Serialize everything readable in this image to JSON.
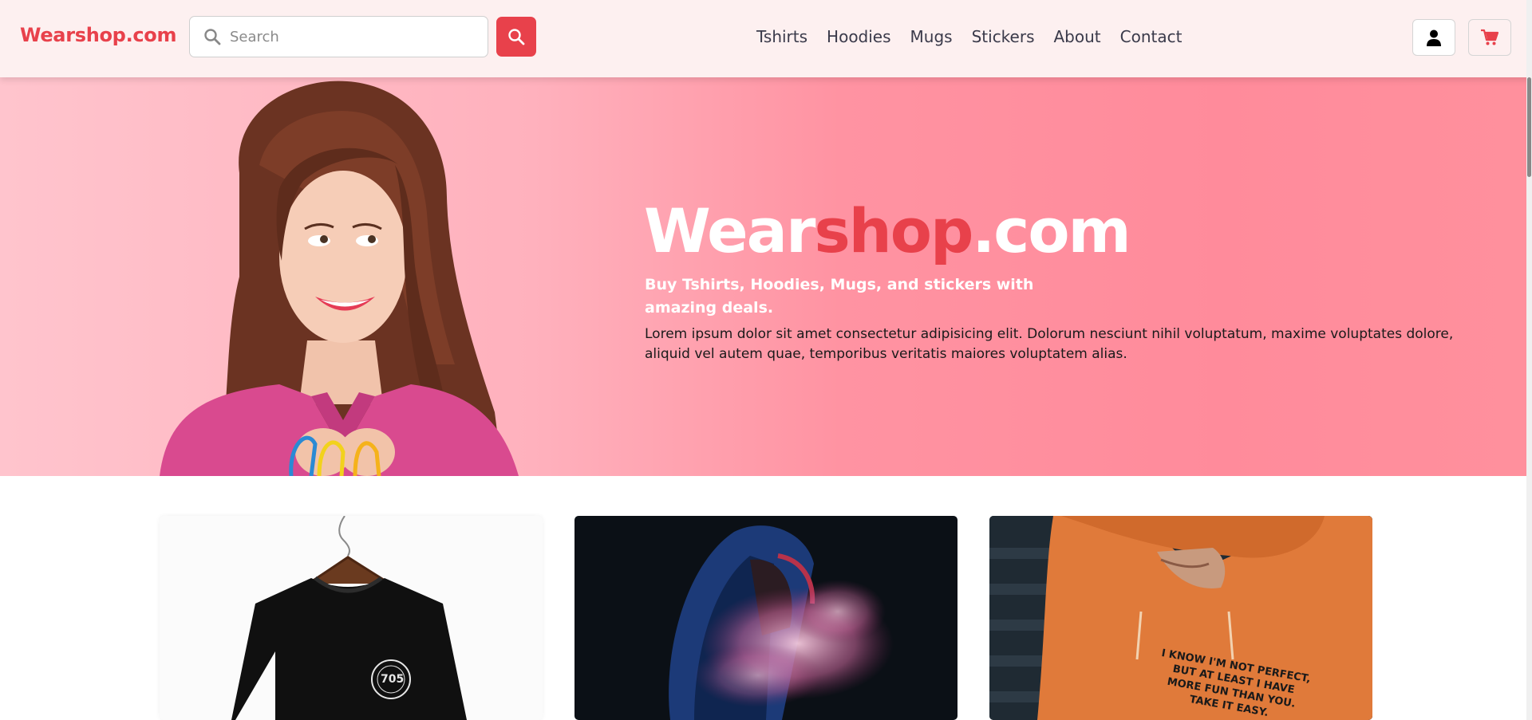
{
  "brand": "Wearshop.com",
  "search": {
    "placeholder": "Search"
  },
  "nav": [
    "Tshirts",
    "Hoodies",
    "Mugs",
    "Stickers",
    "About",
    "Contact"
  ],
  "hero": {
    "title_part1": "Wear",
    "title_part2": "shop",
    "title_part3": ".com",
    "subtitle": "Buy Tshirts, Hoodies, Mugs, and stickers with amazing deals.",
    "body": "Lorem ipsum dolor sit amet consectetur adipisicing elit. Dolorum nesciunt nihil voluptatum, maxime voluptates dolore, aliquid vel autem quae, temporibus veritatis maiores voluptatem alias."
  },
  "products": [
    {
      "image": "black-tshirt-on-hanger",
      "print": "705"
    },
    {
      "image": "person-in-hoodie-with-smoke"
    },
    {
      "image": "orange-hoodie",
      "print_lines": [
        "I KNOW I'M NOT PERFECT,",
        "BUT AT LEAST I HAVE",
        "MORE FUN THAN YOU.",
        "TAKE IT EASY."
      ]
    }
  ],
  "colors": {
    "accent": "#e8414b",
    "header_bg": "#fdf0f0",
    "hero_bg": "#ff93a2"
  },
  "icons": {
    "search": "search-icon",
    "user": "user-icon",
    "cart": "cart-icon"
  }
}
